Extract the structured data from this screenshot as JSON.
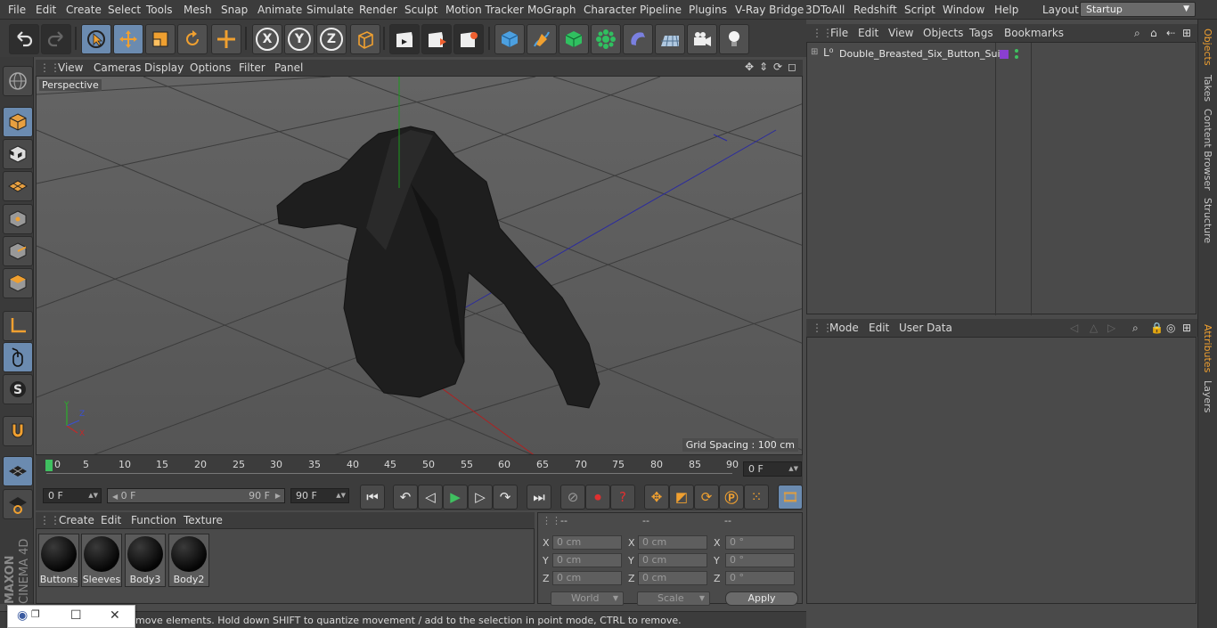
{
  "menubar": {
    "items": [
      "File",
      "Edit",
      "Create",
      "Select",
      "Tools",
      "Mesh",
      "Snap",
      "Animate",
      "Simulate",
      "Render",
      "Sculpt",
      "Motion Tracker",
      "MoGraph",
      "Character",
      "Pipeline",
      "Plugins",
      "V-Ray Bridge",
      "3DToAll",
      "Redshift",
      "Script",
      "Window",
      "Help"
    ],
    "layout_label": "Layout:",
    "layout_value": "Startup"
  },
  "toolbar": {
    "axis_x": "X",
    "axis_y": "Y",
    "axis_z": "Z"
  },
  "viewport": {
    "menus": [
      "View",
      "Cameras",
      "Display",
      "Options",
      "Filter",
      "Panel"
    ],
    "label": "Perspective",
    "grid_spacing": "Grid Spacing : 100 cm",
    "axis_gizmo": {
      "x": "X",
      "y": "Y",
      "z": "Z"
    }
  },
  "timeline": {
    "ticks": [
      "0",
      "5",
      "10",
      "15",
      "20",
      "25",
      "30",
      "35",
      "40",
      "45",
      "50",
      "55",
      "60",
      "65",
      "70",
      "75",
      "80",
      "85",
      "90"
    ],
    "current_frame": "0 F"
  },
  "transport": {
    "start_field": "0 F",
    "range_start": "0 F",
    "range_end": "90 F",
    "end_field": "90 F"
  },
  "materials": {
    "menus": [
      "Create",
      "Edit",
      "Function",
      "Texture"
    ],
    "items": [
      "Buttons",
      "Sleeves",
      "Body3",
      "Body2"
    ]
  },
  "coordinates": {
    "col_headers": [
      "--",
      "--",
      "--"
    ],
    "rows": [
      {
        "axis": "X",
        "pos": "0 cm",
        "size": "0 cm",
        "rot": "0 °"
      },
      {
        "axis": "Y",
        "pos": "0 cm",
        "size": "0 cm",
        "rot": "0 °"
      },
      {
        "axis": "Z",
        "pos": "0 cm",
        "size": "0 cm",
        "rot": "0 °"
      }
    ],
    "mode_select": "World",
    "size_select": "Scale",
    "apply_label": "Apply"
  },
  "object_manager": {
    "menus": [
      "File",
      "Edit",
      "View",
      "Objects",
      "Tags",
      "Bookmarks"
    ],
    "object_name": "Double_Breasted_Six_Button_Suit",
    "tag_color": "#8a3fd0"
  },
  "attribute_manager": {
    "menus": [
      "Mode",
      "Edit",
      "User Data"
    ]
  },
  "right_tabs": [
    "Objects",
    "Takes",
    "Content Browser",
    "Structure",
    "Attributes",
    "Layers"
  ],
  "status": {
    "text": "move elements. Hold down SHIFT to quantize movement / add to the selection in point mode, CTRL to remove."
  },
  "branding": {
    "line1": "MAXON",
    "line2": "CINEMA 4D"
  },
  "colors": {
    "accent": "#f0a030",
    "selection": "#6b8bb0",
    "panel": "#4a4a4a"
  }
}
